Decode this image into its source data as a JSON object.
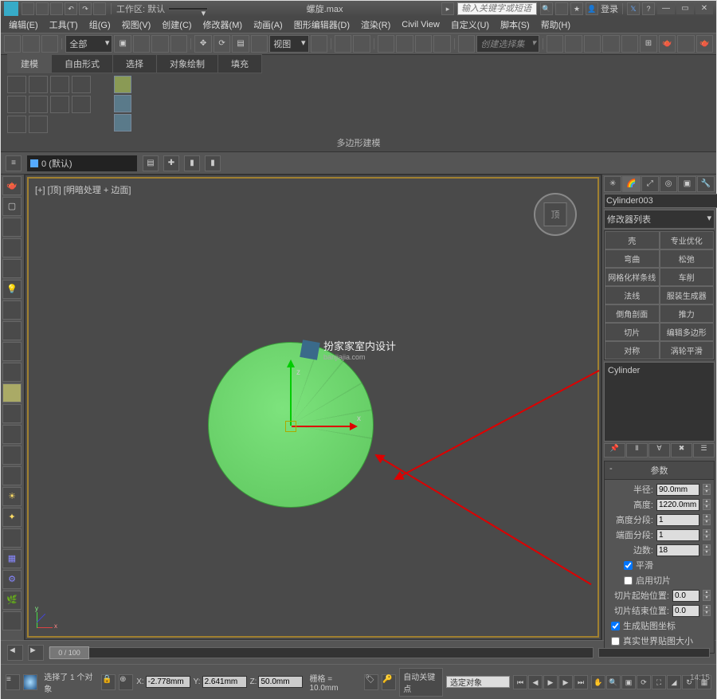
{
  "titlebar": {
    "workspace_label": "工作区: 默认",
    "filename": "螺旋.max",
    "search_placeholder": "输入关键字或短语",
    "login": "登录"
  },
  "menus": [
    "编辑(E)",
    "工具(T)",
    "组(G)",
    "视图(V)",
    "创建(C)",
    "修改器(M)",
    "动画(A)",
    "图形编辑器(D)",
    "渲染(R)",
    "Civil View",
    "自定义(U)",
    "脚本(S)",
    "帮助(H)"
  ],
  "toolbar": {
    "all": "全部",
    "view": "视图",
    "sel_set": "创建选择集"
  },
  "ribbon": {
    "tabs": [
      "建模",
      "自由形式",
      "选择",
      "对象绘制",
      "填充"
    ],
    "panel_label": "多边形建模"
  },
  "subbar": {
    "layer": "0 (默认)"
  },
  "viewport": {
    "label": "[+] [顶] [明暗处理 + 边面]",
    "cube": "顶",
    "axis_z": "z",
    "axis_x": "x"
  },
  "watermark": {
    "title": "扮家家室内设计",
    "sub": "banjiajia.com"
  },
  "right": {
    "obj_name": "Cylinder003",
    "modlist": "修改器列表",
    "mods": [
      [
        "壳",
        "专业优化"
      ],
      [
        "弯曲",
        "松弛"
      ],
      [
        "网格化样条线",
        "车削"
      ],
      [
        "法线",
        "服装生成器"
      ],
      [
        "倒角剖面",
        "推力"
      ],
      [
        "切片",
        "编辑多边形"
      ],
      [
        "对称",
        "涡轮平滑"
      ]
    ],
    "stack_item": "Cylinder",
    "rollout": "参数",
    "radius_lbl": "半径:",
    "radius": "90.0mm",
    "height_lbl": "高度:",
    "height": "1220.0mm",
    "hseg_lbl": "高度分段:",
    "hseg": "1",
    "cseg_lbl": "端面分段:",
    "cseg": "1",
    "sides_lbl": "边数:",
    "sides": "18",
    "smooth": "平滑",
    "slice_on": "启用切片",
    "slice_from_lbl": "切片起始位置:",
    "slice_from": "0.0",
    "slice_to_lbl": "切片结束位置:",
    "slice_to": "0.0",
    "gen_uv": "生成贴图坐标",
    "real_uv": "真实世界贴图大小"
  },
  "timeline": {
    "frame": "0 / 100"
  },
  "status": {
    "selected": "选择了 1 个对象",
    "x": "-2.778mm",
    "y": "2.641mm",
    "z": "50.0mm",
    "grid": "栅格 = 10.0mm",
    "autokey": "自动关键点",
    "seltgt": "选定对象",
    "time": "14:15"
  }
}
